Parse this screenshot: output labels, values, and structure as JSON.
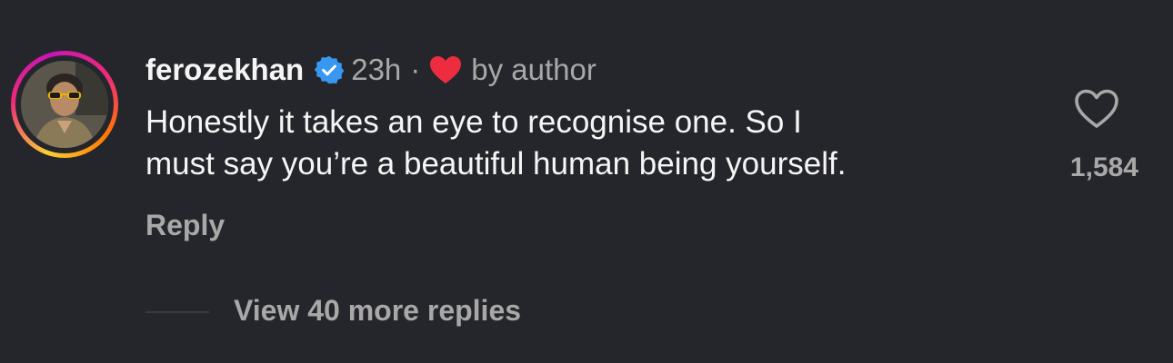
{
  "comment": {
    "username": "ferozekhan",
    "time": "23h",
    "separator": "·",
    "liked_by_author_label": "by author",
    "text_lines": [
      "Honestly it takes an eye to recognise one. So I",
      "must say you’re a beautiful human being yourself."
    ],
    "reply_label": "Reply",
    "like_count": "1,584",
    "view_replies_label": "View 40 more replies"
  },
  "icons": {
    "verified": "verified-badge-icon",
    "author_heart": "heart-filled-icon",
    "like": "heart-outline-icon"
  },
  "colors": {
    "background": "#25262b",
    "primary_text": "#f5f5f5",
    "secondary_text": "#a8a8a8",
    "verified_blue": "#3897f0",
    "heart_red": "#ed2d3f"
  }
}
